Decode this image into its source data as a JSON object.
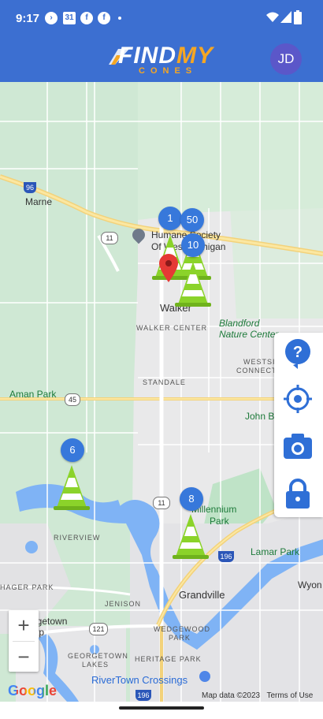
{
  "status": {
    "time": "9:17",
    "notif_icons": [
      "directions-icon",
      "calendar-31-icon",
      "facebook-icon",
      "facebook-icon",
      "dot-icon"
    ],
    "calendar_text": "31",
    "right_icons": [
      "wifi-icon",
      "signal-icon",
      "battery-icon"
    ]
  },
  "appbar": {
    "logo_main_a": "FIND",
    "logo_main_b": "MY",
    "logo_sub": "CONES",
    "avatar_initials": "JD"
  },
  "colors": {
    "appbar": "#3c6fd1",
    "cluster": "#3778db",
    "avatar": "#5b57c9",
    "logo_accent": "#f5a623"
  },
  "map": {
    "labels": {
      "marne": "Marne",
      "humane": "Humane Society",
      "humane2": "Of West Michigan",
      "walker": "Walker",
      "walker_center": "WALKER CENTER",
      "blandford": "Blandford",
      "blandford2": "Nature Center",
      "westside": "WESTSIDE",
      "westside2": "CONNECTION",
      "standale": "STANDALE",
      "aman": "Aman Park",
      "john_ball": "John Ball Zoo",
      "riverview": "RIVERVIEW",
      "millennium": "Millennium",
      "millennium2": "Park",
      "lamar": "Lamar Park",
      "wyo": "Wyon",
      "hager": "HAGER PARK",
      "jenison": "JENISON",
      "grandville": "Grandville",
      "georgetown": "Georgetown",
      "georgetown2": "Twp",
      "wedgewood": "WEDGEWOOD",
      "wedgewood2": "PARK",
      "georgetown_lakes": "GEORGETOWN",
      "georgetown_lakes2": "LAKES",
      "heritage": "HERITAGE PARK",
      "rivertown": "RiverTown Crossings"
    },
    "shields": {
      "i96_top": "96",
      "r11_top": "11",
      "r45": "45",
      "r11_bottom": "11",
      "i196": "196",
      "r121": "121",
      "i196_bottom": "196"
    },
    "clusters": {
      "c1": "1",
      "c50": "50",
      "c10": "10",
      "c6": "6",
      "c8": "8"
    },
    "google": "Google",
    "attribution": "Map data ©2023",
    "terms": "Terms of Use"
  },
  "controls": {
    "zoom_in": "+",
    "zoom_out": "−"
  }
}
